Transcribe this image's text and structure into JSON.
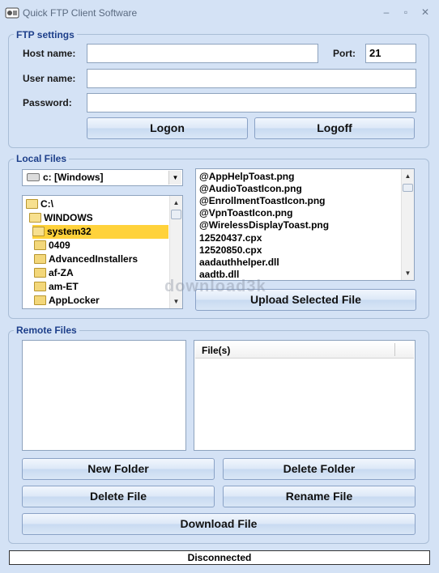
{
  "window": {
    "title": "Quick FTP Client Software",
    "controls": {
      "minimize": "–",
      "restore": "▫",
      "close": "✕"
    }
  },
  "ftp_settings": {
    "legend": "FTP settings",
    "host_label": "Host name:",
    "host_value": "",
    "port_label": "Port:",
    "port_value": "21",
    "user_label": "User name:",
    "user_value": "",
    "password_label": "Password:",
    "password_value": "",
    "logon_label": "Logon",
    "logoff_label": "Logoff"
  },
  "local_files": {
    "legend": "Local Files",
    "drive_selected": "c: [Windows]",
    "tree": [
      {
        "label": "C:\\",
        "type": "drive-folder"
      },
      {
        "label": "WINDOWS",
        "type": "open-folder"
      },
      {
        "label": "system32",
        "type": "open-folder",
        "selected": true
      },
      {
        "label": "0409",
        "type": "folder"
      },
      {
        "label": "AdvancedInstallers",
        "type": "folder"
      },
      {
        "label": "af-ZA",
        "type": "folder"
      },
      {
        "label": "am-ET",
        "type": "folder"
      },
      {
        "label": "AppLocker",
        "type": "folder"
      }
    ],
    "files": [
      "@AppHelpToast.png",
      "@AudioToastIcon.png",
      "@EnrollmentToastIcon.png",
      "@VpnToastIcon.png",
      "@WirelessDisplayToast.png",
      "12520437.cpx",
      "12520850.cpx",
      "aadauthhelper.dll",
      "aadtb.dll"
    ],
    "upload_label": "Upload Selected File"
  },
  "remote_files": {
    "legend": "Remote Files",
    "files_header": "File(s)",
    "new_folder_label": "New Folder",
    "delete_folder_label": "Delete Folder",
    "delete_file_label": "Delete File",
    "rename_file_label": "Rename File",
    "download_label": "Download File"
  },
  "status": {
    "text": "Disconnected"
  },
  "watermark": {
    "text": "download3k"
  },
  "colors": {
    "background": "#d4e2f5",
    "legend": "#1d3f8a",
    "selection": "#ffd23b"
  }
}
